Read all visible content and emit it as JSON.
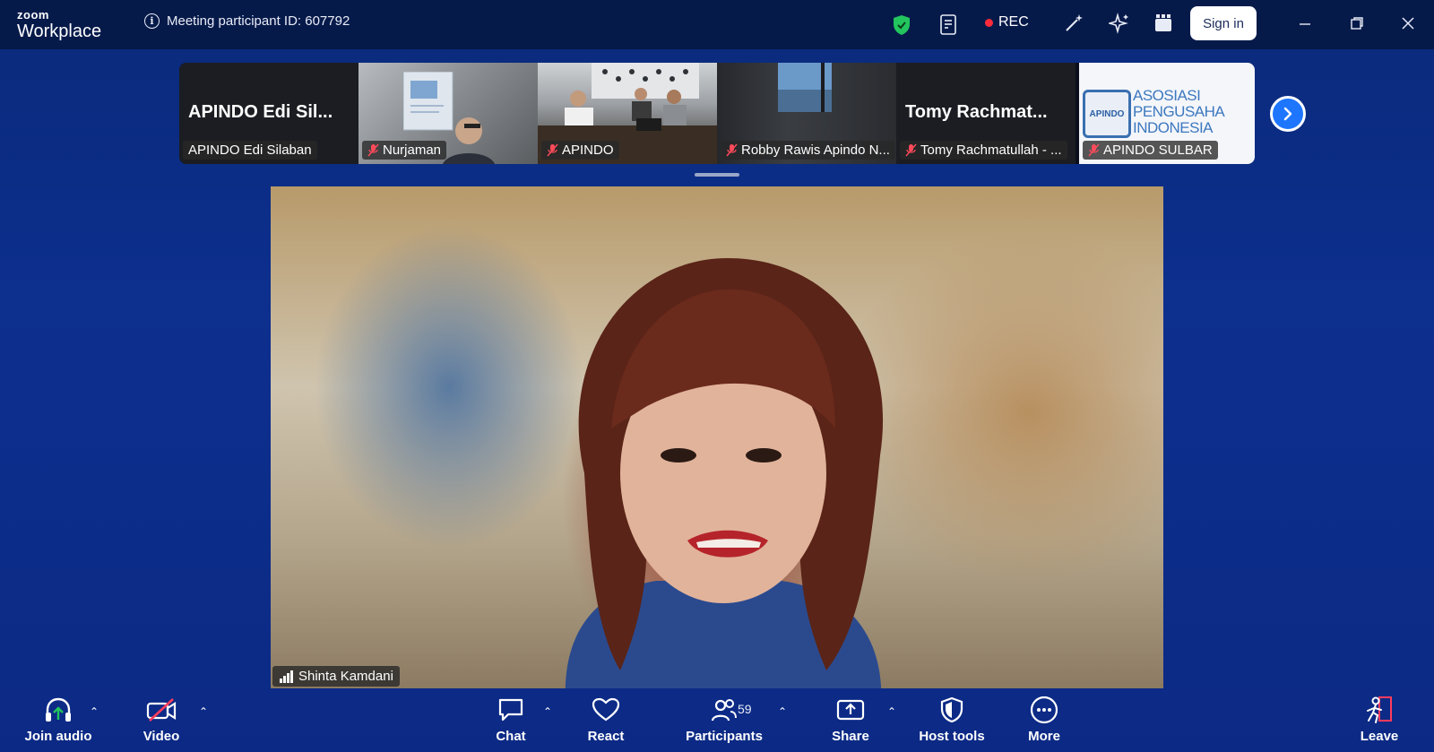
{
  "app": {
    "brand_small": "zoom",
    "brand_large": "Workplace"
  },
  "header": {
    "meeting_id": "Meeting participant ID: 607792",
    "rec_label": "REC",
    "signin_label": "Sign in"
  },
  "gallery": {
    "tiles": [
      {
        "big_name": "APINDO Edi Sil...",
        "label": "APINDO Edi Silaban",
        "muted": false
      },
      {
        "big_name": "",
        "label": "Nurjaman",
        "muted": true
      },
      {
        "big_name": "",
        "label": "APINDO",
        "muted": true
      },
      {
        "big_name": "",
        "label": "Robby Rawis Apindo N...",
        "muted": true
      },
      {
        "big_name": "Tomy  Rachmat...",
        "label": "Tomy Rachmatullah - ...",
        "muted": true
      },
      {
        "big_name": "",
        "label": "APINDO SULBAR",
        "muted": true,
        "logo_short": "APINDO",
        "logo_text": [
          "ASOSIASI",
          "PENGUSAHA",
          "INDONESIA"
        ]
      }
    ]
  },
  "speaker": {
    "name": "Shinta Kamdani"
  },
  "toolbar": {
    "join_audio": "Join audio",
    "video": "Video",
    "chat": "Chat",
    "react": "React",
    "participants": "Participants",
    "participants_count": "59",
    "share": "Share",
    "host_tools": "Host tools",
    "more": "More",
    "leave": "Leave"
  },
  "colors": {
    "accent": "#1e76ff",
    "record": "#ff2a3a",
    "shield": "#22c55e",
    "leave": "#ff3b5c"
  }
}
